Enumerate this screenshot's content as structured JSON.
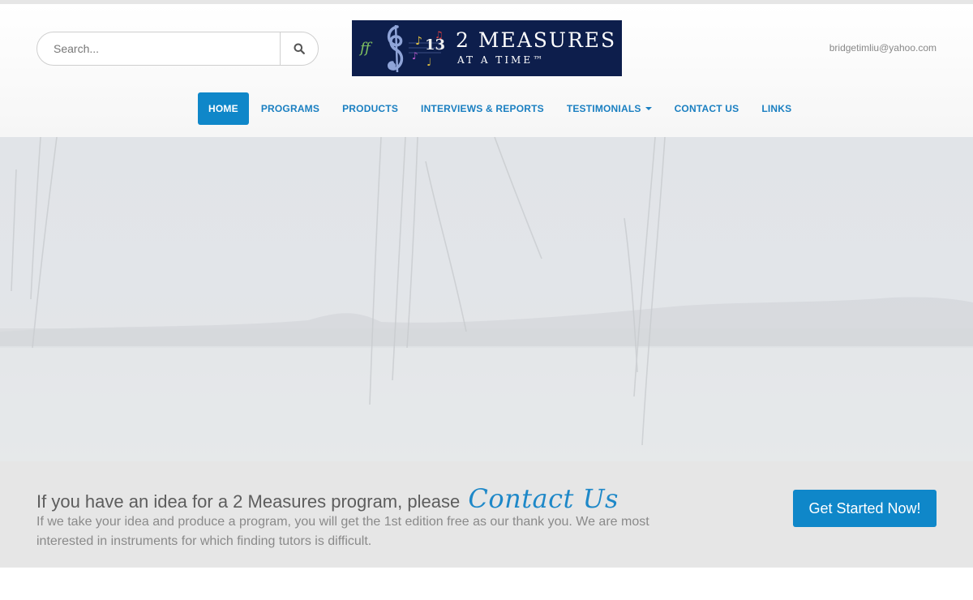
{
  "search": {
    "placeholder": "Search...",
    "icon": "search-icon"
  },
  "logo": {
    "line1": "2 MEASURES",
    "line2": "AT A TIME™",
    "background": "#0d1e4c"
  },
  "header": {
    "email": "bridgetimliu@yahoo.com"
  },
  "nav": {
    "items": [
      {
        "label": "HOME",
        "active": true
      },
      {
        "label": "PROGRAMS"
      },
      {
        "label": "PRODUCTS"
      },
      {
        "label": "INTERVIEWS & REPORTS"
      },
      {
        "label": "TESTIMONIALS",
        "dropdown": true
      },
      {
        "label": "CONTACT US"
      },
      {
        "label": "LINKS"
      }
    ]
  },
  "callout": {
    "heading": "If you have an idea for a 2 Measures program, please",
    "link": "Contact Us",
    "text": "If we take your idea and produce a program, you will get the 1st edition free as our thank you. We are most interested in instruments for which finding tutors is difficult.",
    "button": "Get Started Now!"
  },
  "colors": {
    "accent": "#0f87c9",
    "nav_text": "#1a7fc1",
    "callout_bg": "#e6e6e6"
  }
}
